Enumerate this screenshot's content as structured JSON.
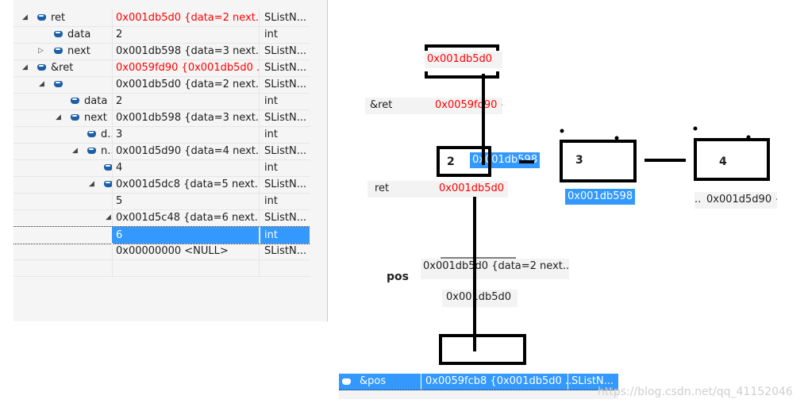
{
  "watch": {
    "rows": [
      {
        "name": "ret",
        "value": "0x001db5d0 {data=2 next...",
        "type": "SListN...",
        "red": true
      },
      {
        "name": "data",
        "value": "2",
        "type": "int"
      },
      {
        "name": "next",
        "value": "0x001db598 {data=3 next...",
        "type": "SListN..."
      },
      {
        "name": "&ret",
        "value": "0x0059fd90 {0x001db5d0 ...",
        "type": "SListN...",
        "red": true
      },
      {
        "name": "",
        "value": "0x001db5d0 {data=2 next...",
        "type": "SListN..."
      },
      {
        "name": "data",
        "value": "2",
        "type": "int"
      },
      {
        "name": "next",
        "value": "0x001db598 {data=3 next...",
        "type": "SListN..."
      },
      {
        "name": "d..",
        "value": "3",
        "type": "int"
      },
      {
        "name": "n..",
        "value": "0x001d5d90 {data=4 next...",
        "type": "SListN..."
      },
      {
        "name": "",
        "value": "4",
        "type": "int"
      },
      {
        "name": "",
        "value": "0x001d5dc8 {data=5 next...",
        "type": "SListN..."
      },
      {
        "name": "",
        "value": "5",
        "type": "int"
      },
      {
        "name": "",
        "value": "0x001d5c48 {data=6 next...",
        "type": "SListN..."
      },
      {
        "name": "",
        "value": "6",
        "type": "int",
        "selected": true
      },
      {
        "name": "",
        "value": "0x00000000 <NULL>",
        "type": "SListN..."
      },
      {
        "name": "",
        "value": "",
        "type": ""
      }
    ]
  },
  "diagram": {
    "top_value": "0x001db5d0",
    "ref_ret": {
      "name": "&ret",
      "value": "0x0059fd90 {"
    },
    "ret": {
      "name": "ret",
      "value": "0x001db5d0"
    },
    "node1": {
      "data": "2",
      "next": "0x001db598"
    },
    "node2": {
      "data": "3",
      "addr": "0x001db598"
    },
    "node3": {
      "data": "4",
      "addr": "0x001d5d90 {",
      "prefix": ".."
    },
    "pos_label": "pos",
    "pos_value": "0x001db5d0 {data=2 next...",
    "pos_addr": "0x001db5d0",
    "ref_pos": {
      "name": "&pos",
      "value": "0x0059fcb8 {0x001db5d0 ...",
      "type": "SListN..."
    }
  },
  "watermark": "https://blog.csdn.net/qq_41152046",
  "colors": {
    "selection": "#3399ff",
    "changed_value": "#ff0000"
  }
}
